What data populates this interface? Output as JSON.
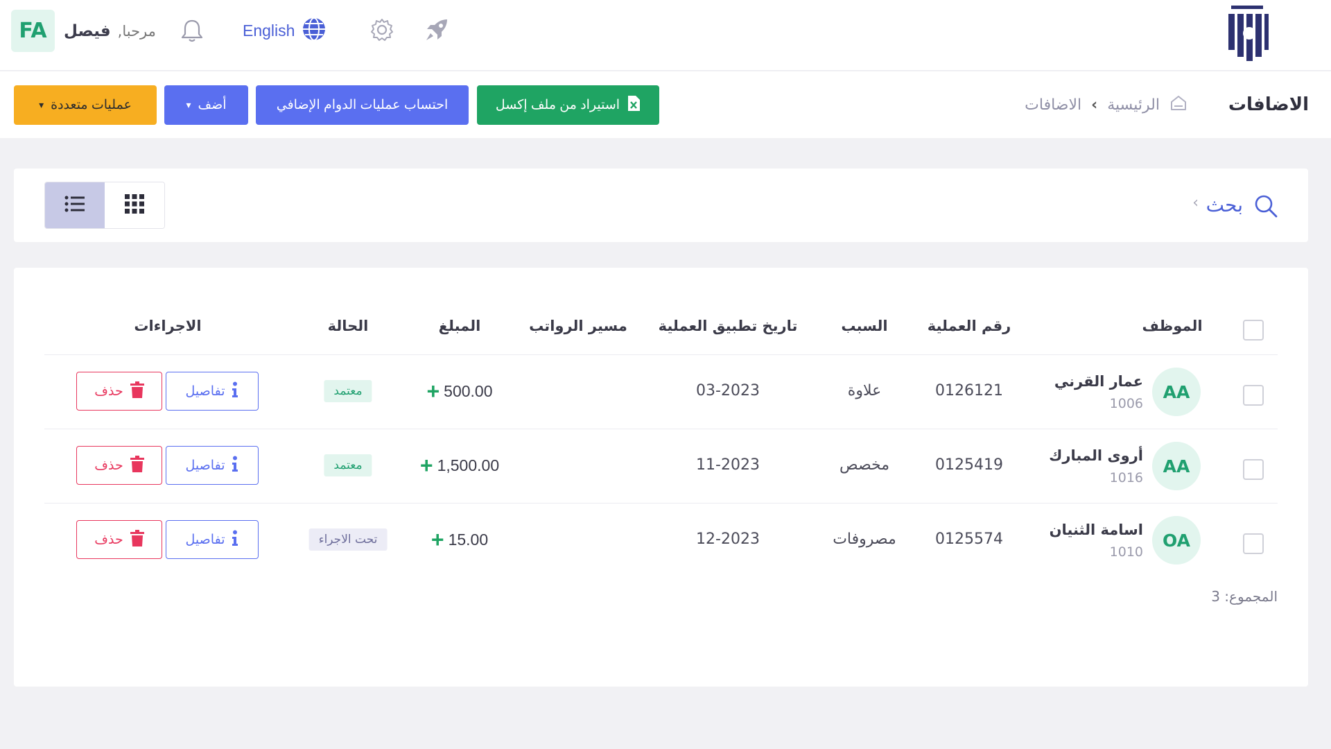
{
  "topbar": {
    "avatar_initials": "FA",
    "greeting": "مرحبا,",
    "user_name": "فيصل",
    "language_label": "English",
    "icons": [
      "bell-icon",
      "globe-icon",
      "gear-icon",
      "rocket-icon",
      "brand-logo"
    ]
  },
  "header": {
    "page_title": "الاضافات",
    "breadcrumb_home": "الرئيسية",
    "breadcrumb_current": "الاضافات"
  },
  "toolbar": {
    "import_excel_label": "استيراد من ملف إكسل",
    "calc_overtime_label": "احتساب عمليات الدوام الإضافي",
    "add_label": "أضف",
    "multi_ops_label": "عمليات متعددة"
  },
  "search": {
    "label": "بحث"
  },
  "table": {
    "columns": {
      "employee": "الموظف",
      "operation_no": "رقم العملية",
      "reason": "السبب",
      "apply_date": "تاريخ تطبيق العملية",
      "payroll": "مسير الرواتب",
      "amount": "المبلغ",
      "status": "الحالة",
      "actions": "الاجراءات"
    },
    "rows": [
      {
        "initials": "AA",
        "name": "عمار القرني",
        "emp_id": "1006",
        "operation_no": "0126121",
        "reason": "علاوة",
        "apply_date": "03-2023",
        "payroll": "",
        "amount": "500.00",
        "status": "معتمد",
        "status_type": "approved",
        "details_label": "تفاصيل",
        "delete_label": "حذف"
      },
      {
        "initials": "AA",
        "name": "أروى المبارك",
        "emp_id": "1016",
        "operation_no": "0125419",
        "reason": "مخصص",
        "apply_date": "11-2023",
        "payroll": "",
        "amount": "1,500.00",
        "status": "معتمد",
        "status_type": "approved",
        "details_label": "تفاصيل",
        "delete_label": "حذف"
      },
      {
        "initials": "OA",
        "name": "اسامة الثنيان",
        "emp_id": "1010",
        "operation_no": "0125574",
        "reason": "مصروفات",
        "apply_date": "12-2023",
        "payroll": "",
        "amount": "15.00",
        "status": "تحت الاجراء",
        "status_type": "pending",
        "details_label": "تفاصيل",
        "delete_label": "حذف"
      }
    ],
    "total_label": "المجموع: 3"
  },
  "colors": {
    "primary": "#5a6ff0",
    "success": "#1fa463",
    "warning": "#f7ae21",
    "danger": "#e8365d",
    "avatar_bg": "#e2f5ee"
  }
}
